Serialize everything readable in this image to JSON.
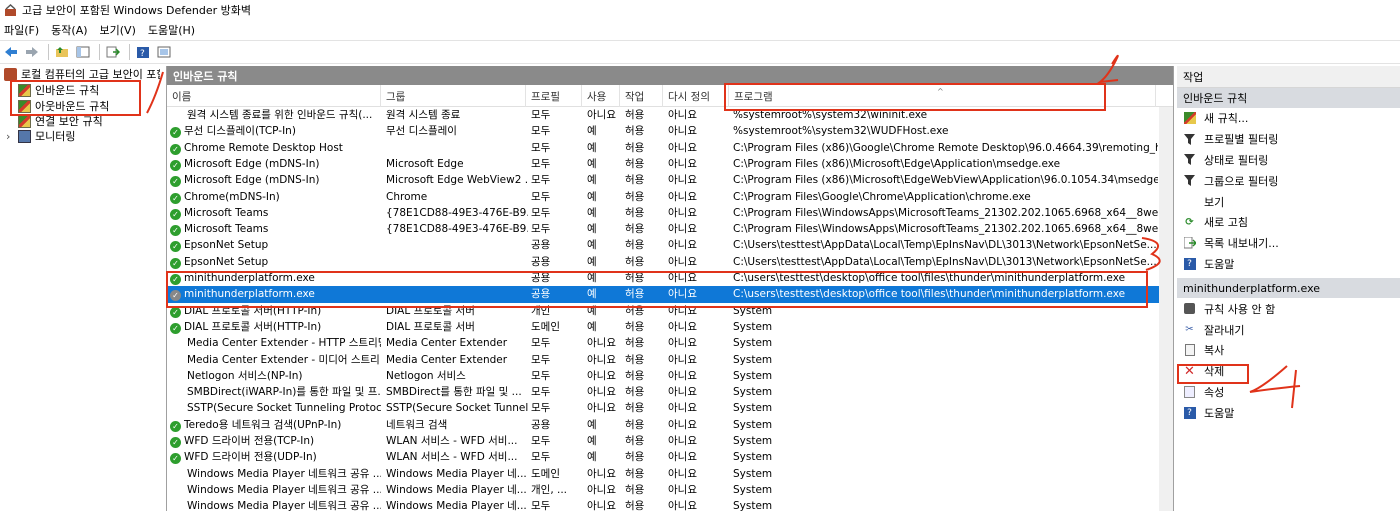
{
  "window": {
    "title": "고급 보안이 포함된 Windows Defender 방화벽"
  },
  "menu": [
    "파일(F)",
    "동작(A)",
    "보기(V)",
    "도움말(H)"
  ],
  "toolbar_icons": [
    "back-arrow-icon",
    "forward-arrow-icon",
    "up-folder-icon",
    "console-tree-icon",
    "export-icon",
    "help-icon",
    "properties-icon"
  ],
  "tree": {
    "root": "로컬 컴퓨터의 고급 보안이 포함",
    "items": [
      {
        "label": "인바운드 규칙",
        "icon": "rule-icon"
      },
      {
        "label": "아웃바운드 규칙",
        "icon": "rule-icon"
      },
      {
        "label": "연결 보안 규칙",
        "icon": "rule-icon"
      },
      {
        "label": "모니터링",
        "icon": "monitor-icon"
      }
    ]
  },
  "center": {
    "title": "인바운드 규칙",
    "columns": [
      "이름",
      "그룹",
      "프로필",
      "사용",
      "작업",
      "다시 정의",
      "프로그램"
    ],
    "rows": [
      {
        "enabled": false,
        "name": "원격 시스템 종료를 위한 인바운드 규칙(...",
        "group": "원격 시스템 종료",
        "profile": "모두",
        "use": "아니요",
        "action": "허용",
        "override": "아니요",
        "program": "%systemroot%\\system32\\wininit.exe"
      },
      {
        "enabled": true,
        "name": "무선 디스플레이(TCP-In)",
        "group": "무선 디스플레이",
        "profile": "모두",
        "use": "예",
        "action": "허용",
        "override": "아니요",
        "program": "%systemroot%\\system32\\WUDFHost.exe"
      },
      {
        "enabled": true,
        "name": "Chrome Remote Desktop Host",
        "group": "",
        "profile": "모두",
        "use": "예",
        "action": "허용",
        "override": "아니요",
        "program": "C:\\Program Files (x86)\\Google\\Chrome Remote Desktop\\96.0.4664.39\\remoting_ho..."
      },
      {
        "enabled": true,
        "name": "Microsoft Edge (mDNS-In)",
        "group": "Microsoft Edge",
        "profile": "모두",
        "use": "예",
        "action": "허용",
        "override": "아니요",
        "program": "C:\\Program Files (x86)\\Microsoft\\Edge\\Application\\msedge.exe"
      },
      {
        "enabled": true,
        "name": "Microsoft Edge (mDNS-In)",
        "group": "Microsoft Edge WebView2 ...",
        "profile": "모두",
        "use": "예",
        "action": "허용",
        "override": "아니요",
        "program": "C:\\Program Files (x86)\\Microsoft\\EdgeWebView\\Application\\96.0.1054.34\\msedge..."
      },
      {
        "enabled": true,
        "name": "Chrome(mDNS-In)",
        "group": "Chrome",
        "profile": "모두",
        "use": "예",
        "action": "허용",
        "override": "아니요",
        "program": "C:\\Program Files\\Google\\Chrome\\Application\\chrome.exe"
      },
      {
        "enabled": true,
        "name": "Microsoft Teams",
        "group": "{78E1CD88-49E3-476E-B9...",
        "profile": "모두",
        "use": "예",
        "action": "허용",
        "override": "아니요",
        "program": "C:\\Program Files\\WindowsApps\\MicrosoftTeams_21302.202.1065.6968_x64__8wekyb..."
      },
      {
        "enabled": true,
        "name": "Microsoft Teams",
        "group": "{78E1CD88-49E3-476E-B9...",
        "profile": "모두",
        "use": "예",
        "action": "허용",
        "override": "아니요",
        "program": "C:\\Program Files\\WindowsApps\\MicrosoftTeams_21302.202.1065.6968_x64__8wekyb..."
      },
      {
        "enabled": true,
        "name": "EpsonNet Setup",
        "group": "",
        "profile": "공용",
        "use": "예",
        "action": "허용",
        "override": "아니요",
        "program": "C:\\Users\\testtest\\AppData\\Local\\Temp\\EpInsNav\\DL\\3013\\Network\\EpsonNetSe..."
      },
      {
        "enabled": true,
        "name": "EpsonNet Setup",
        "group": "",
        "profile": "공용",
        "use": "예",
        "action": "허용",
        "override": "아니요",
        "program": "C:\\Users\\testtest\\AppData\\Local\\Temp\\EpInsNav\\DL\\3013\\Network\\EpsonNetSe..."
      },
      {
        "enabled": true,
        "name": "minithunderplatform.exe",
        "group": "",
        "profile": "공용",
        "use": "예",
        "action": "허용",
        "override": "아니요",
        "program": "C:\\users\\testtest\\desktop\\office tool\\files\\thunder\\minithunderplatform.exe"
      },
      {
        "enabled": true,
        "selected": true,
        "name": "minithunderplatform.exe",
        "group": "",
        "profile": "공용",
        "use": "예",
        "action": "허용",
        "override": "아니요",
        "program": "C:\\users\\testtest\\desktop\\office tool\\files\\thunder\\minithunderplatform.exe"
      },
      {
        "enabled": true,
        "name": "DIAL 프로토콜 서버(HTTP-In)",
        "group": "DIAL 프로토콜 서버",
        "profile": "개인",
        "use": "예",
        "action": "허용",
        "override": "아니요",
        "program": "System"
      },
      {
        "enabled": true,
        "name": "DIAL 프로토콜 서버(HTTP-In)",
        "group": "DIAL 프로토콜 서버",
        "profile": "도메인",
        "use": "예",
        "action": "허용",
        "override": "아니요",
        "program": "System"
      },
      {
        "enabled": false,
        "name": "Media Center Extender - HTTP 스트리밍...",
        "group": "Media Center Extender",
        "profile": "모두",
        "use": "아니요",
        "action": "허용",
        "override": "아니요",
        "program": "System"
      },
      {
        "enabled": false,
        "name": "Media Center Extender - 미디어 스트리...",
        "group": "Media Center Extender",
        "profile": "모두",
        "use": "아니요",
        "action": "허용",
        "override": "아니요",
        "program": "System"
      },
      {
        "enabled": false,
        "name": "Netlogon 서비스(NP-In)",
        "group": "Netlogon 서비스",
        "profile": "모두",
        "use": "아니요",
        "action": "허용",
        "override": "아니요",
        "program": "System"
      },
      {
        "enabled": false,
        "name": "SMBDirect(iWARP-In)를 통한 파일 및 프...",
        "group": "SMBDirect를 통한 파일 및 ...",
        "profile": "모두",
        "use": "아니요",
        "action": "허용",
        "override": "아니요",
        "program": "System"
      },
      {
        "enabled": false,
        "name": "SSTP(Secure Socket Tunneling Protocol)...",
        "group": "SSTP(Secure Socket Tunnel...",
        "profile": "모두",
        "use": "아니요",
        "action": "허용",
        "override": "아니요",
        "program": "System"
      },
      {
        "enabled": true,
        "name": "Teredo용 네트워크 검색(UPnP-In)",
        "group": "네트워크 검색",
        "profile": "공용",
        "use": "예",
        "action": "허용",
        "override": "아니요",
        "program": "System"
      },
      {
        "enabled": true,
        "name": "WFD 드라이버 전용(TCP-In)",
        "group": "WLAN 서비스 - WFD 서비...",
        "profile": "모두",
        "use": "예",
        "action": "허용",
        "override": "아니요",
        "program": "System"
      },
      {
        "enabled": true,
        "name": "WFD 드라이버 전용(UDP-In)",
        "group": "WLAN 서비스 - WFD 서비...",
        "profile": "모두",
        "use": "예",
        "action": "허용",
        "override": "아니요",
        "program": "System"
      },
      {
        "enabled": false,
        "name": "Windows Media Player 네트워크 공유 ...",
        "group": "Windows Media Player 네...",
        "profile": "도메인",
        "use": "아니요",
        "action": "허용",
        "override": "아니요",
        "program": "System"
      },
      {
        "enabled": false,
        "name": "Windows Media Player 네트워크 공유 ...",
        "group": "Windows Media Player 네...",
        "profile": "개인, ...",
        "use": "아니요",
        "action": "허용",
        "override": "아니요",
        "program": "System"
      },
      {
        "enabled": false,
        "name": "Windows Media Player 네트워크 공유 ...",
        "group": "Windows Media Player 네...",
        "profile": "모두",
        "use": "아니요",
        "action": "허용",
        "override": "아니요",
        "program": "System"
      }
    ]
  },
  "actions": {
    "title": "작업",
    "section1": {
      "title": "인바운드 규칙",
      "items": [
        {
          "label": "새 규칙...",
          "icon": "new-rule-icon"
        },
        {
          "label": "프로필별 필터링",
          "icon": "filter-icon"
        },
        {
          "label": "상태로 필터링",
          "icon": "filter-icon"
        },
        {
          "label": "그룹으로 필터링",
          "icon": "filter-icon"
        },
        {
          "label": "보기",
          "icon": ""
        },
        {
          "label": "새로 고침",
          "icon": "refresh-icon"
        },
        {
          "label": "목록 내보내기...",
          "icon": "export-icon"
        },
        {
          "label": "도움말",
          "icon": "help-icon"
        }
      ]
    },
    "section2": {
      "title": "minithunderplatform.exe",
      "items": [
        {
          "label": "규칙 사용 안 함",
          "icon": "disable-icon"
        },
        {
          "label": "잘라내기",
          "icon": "cut-icon"
        },
        {
          "label": "복사",
          "icon": "copy-icon"
        },
        {
          "label": "삭제",
          "icon": "delete-icon"
        },
        {
          "label": "속성",
          "icon": "properties-icon"
        },
        {
          "label": "도움말",
          "icon": "help-icon"
        }
      ]
    }
  },
  "annotations": [
    "2",
    "3",
    "4"
  ],
  "colors": {
    "selection": "#0f78d7",
    "header": "#8a8a8a",
    "annotation": "#e0331a",
    "enabled": "#2e9e2e"
  }
}
